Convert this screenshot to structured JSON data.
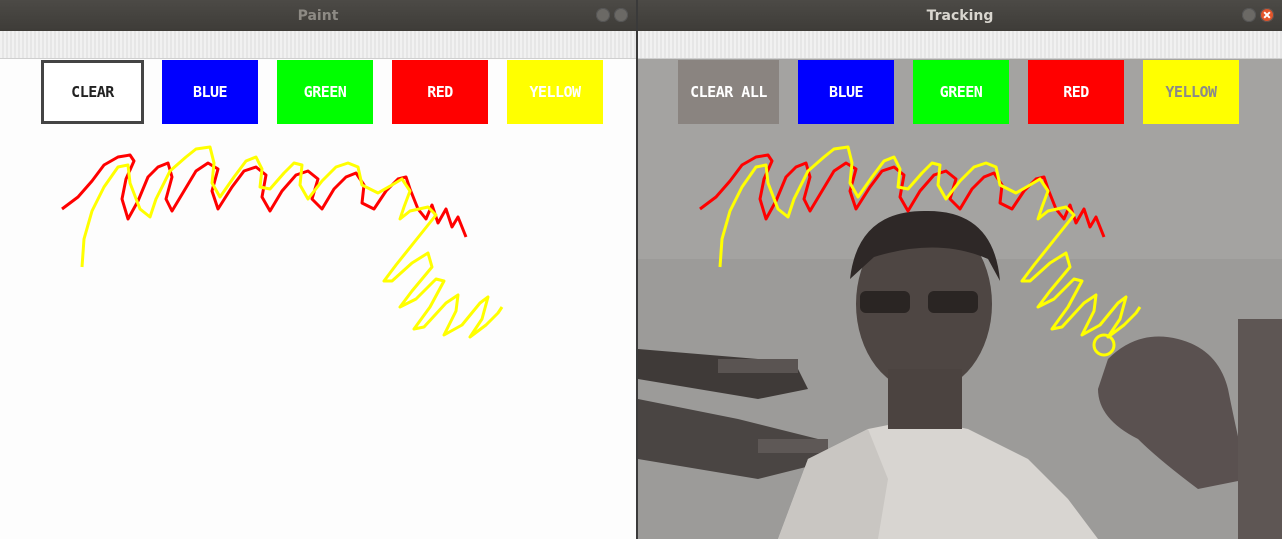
{
  "paint_window": {
    "title": "Paint",
    "buttons": [
      {
        "label": "CLEAR",
        "color": "#ffffff",
        "text_color": "#222222"
      },
      {
        "label": "BLUE",
        "color": "#0000ff",
        "text_color": "#ffffff"
      },
      {
        "label": "GREEN",
        "color": "#00ff00",
        "text_color": "#ffffff"
      },
      {
        "label": "RED",
        "color": "#ff0000",
        "text_color": "#ffffff"
      },
      {
        "label": "YELLOW",
        "color": "#ffff00",
        "text_color": "#ffffff"
      }
    ]
  },
  "tracking_window": {
    "title": "Tracking",
    "buttons": [
      {
        "label": "CLEAR ALL",
        "color": "#8a8480",
        "text_color": "#ffffff"
      },
      {
        "label": "BLUE",
        "color": "#0000ff",
        "text_color": "#ffffff"
      },
      {
        "label": "GREEN",
        "color": "#00ff00",
        "text_color": "#ffffff"
      },
      {
        "label": "RED",
        "color": "#ff0000",
        "text_color": "#ffffff"
      },
      {
        "label": "YELLOW",
        "color": "#ffff00",
        "text_color": "#8a8a8a"
      }
    ]
  },
  "strokes": {
    "red_color": "#ff0000",
    "yellow_color": "#ffff00"
  }
}
